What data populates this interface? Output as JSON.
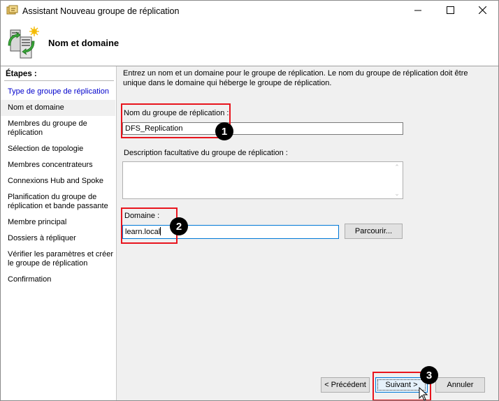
{
  "window": {
    "title": "Assistant Nouveau groupe de réplication",
    "controls": [
      "minimize-icon",
      "maximize-icon",
      "close-icon"
    ]
  },
  "header": {
    "title": "Nom et domaine",
    "icon": "replication-server-icon"
  },
  "steps": {
    "heading": "Étapes :",
    "items": [
      {
        "label": "Type de groupe de réplication",
        "state": "link"
      },
      {
        "label": "Nom et domaine",
        "state": "current"
      },
      {
        "label": "Membres du groupe de réplication",
        "state": "normal"
      },
      {
        "label": "Sélection de topologie",
        "state": "normal"
      },
      {
        "label": "Membres concentrateurs",
        "state": "normal"
      },
      {
        "label": "Connexions Hub and Spoke",
        "state": "normal"
      },
      {
        "label": "Planification du groupe de réplication et bande passante",
        "state": "normal"
      },
      {
        "label": "Membre principal",
        "state": "normal"
      },
      {
        "label": "Dossiers à répliquer",
        "state": "normal"
      },
      {
        "label": "Vérifier les paramètres et créer le groupe de réplication",
        "state": "normal"
      },
      {
        "label": "Confirmation",
        "state": "normal"
      }
    ]
  },
  "main": {
    "intro": "Entrez un nom et un domaine pour le groupe de réplication. Le nom du groupe de réplication doit être unique dans le domaine qui héberge le groupe de réplication.",
    "group_name_label": "Nom du groupe de réplication :",
    "group_name_value": "DFS_Replication",
    "description_label": "Description facultative du groupe de réplication :",
    "description_value": "",
    "domain_label": "Domaine :",
    "domain_value": "learn.local",
    "browse_button": "Parcourir..."
  },
  "footer": {
    "previous_button": "< Précédent",
    "next_button": "Suivant >",
    "cancel_button": "Annuler"
  },
  "annotations": {
    "color": "#e8141d",
    "badges": [
      "1",
      "2",
      "3"
    ]
  },
  "colors": {
    "link": "#0000cc",
    "primary_button_border": "#0078d7"
  }
}
